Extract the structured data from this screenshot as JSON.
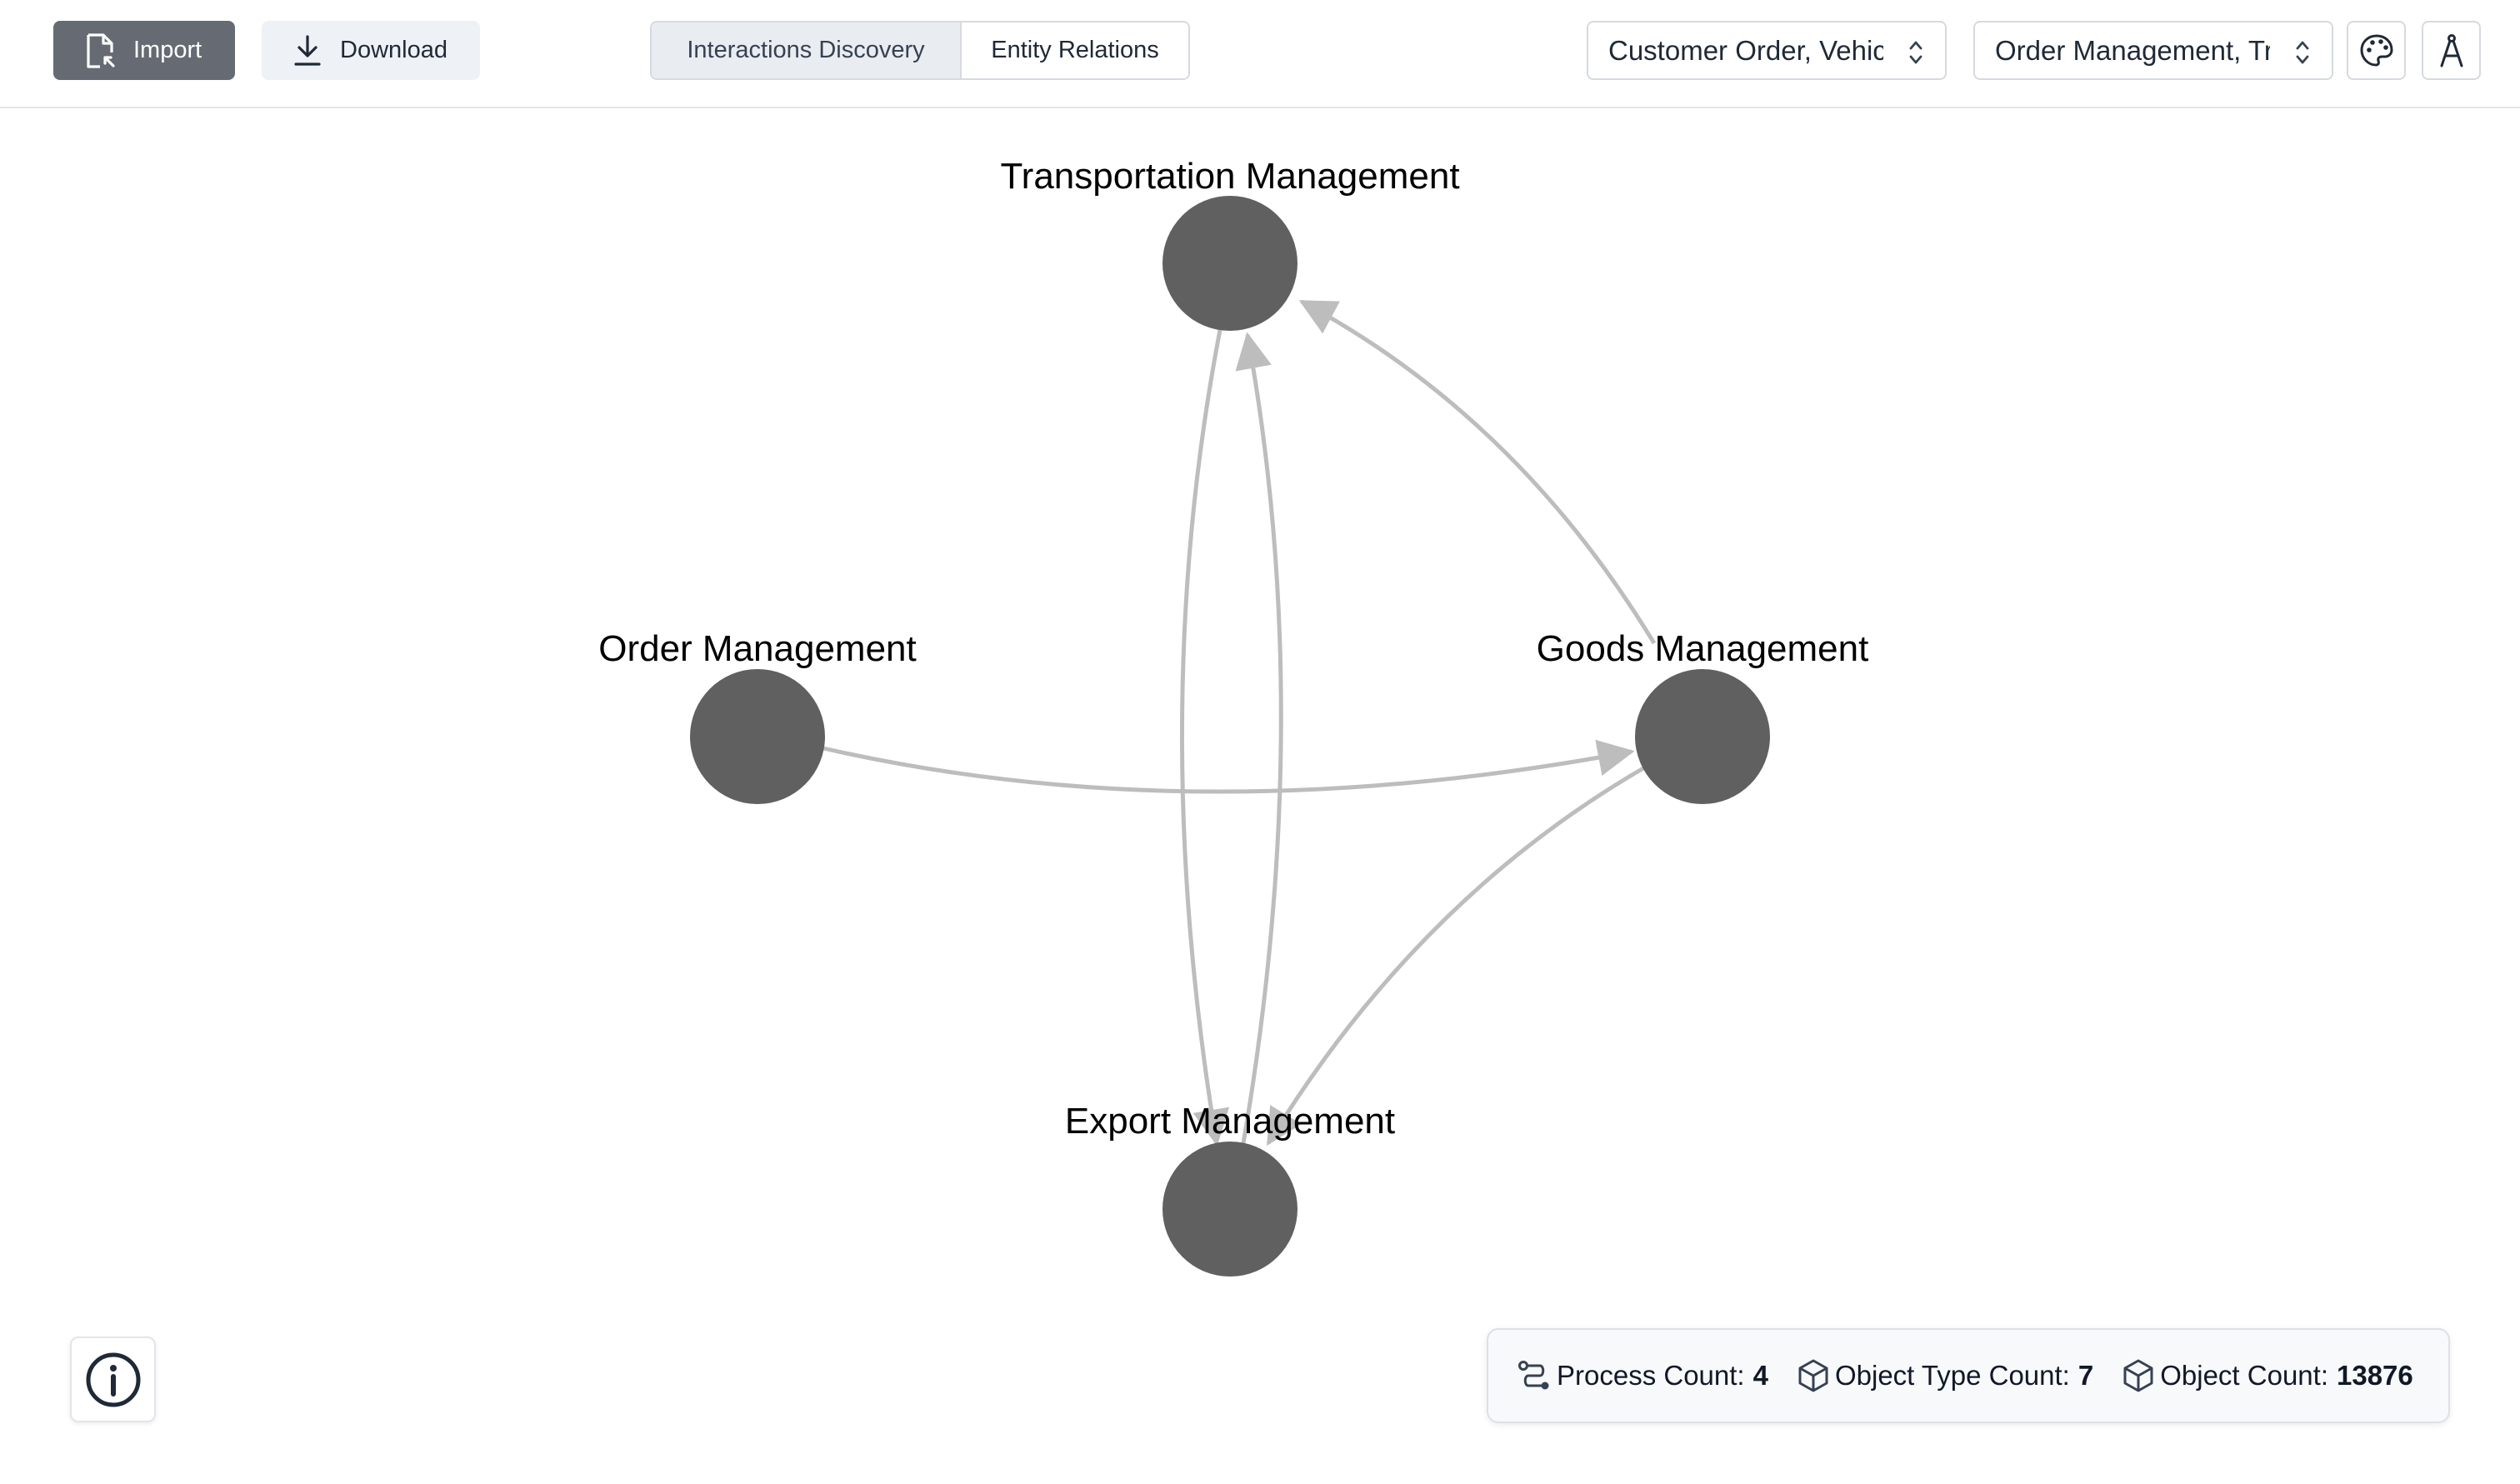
{
  "toolbar": {
    "import_label": "Import",
    "download_label": "Download",
    "tabs": [
      {
        "label": "Interactions Discovery",
        "active": true
      },
      {
        "label": "Entity Relations",
        "active": false
      }
    ],
    "object_type_select": {
      "value": "Customer Order, Vehicle"
    },
    "process_select": {
      "value": "Order Management, Transportation Management"
    },
    "icons": [
      "palette-icon",
      "compass-icon"
    ]
  },
  "graph": {
    "nodes": [
      {
        "id": "transportation",
        "label": "Transportation Management"
      },
      {
        "id": "order",
        "label": "Order Management"
      },
      {
        "id": "goods",
        "label": "Goods Management"
      },
      {
        "id": "export",
        "label": "Export Management"
      }
    ],
    "edges": [
      {
        "from": "order",
        "to": "goods"
      },
      {
        "from": "goods",
        "to": "transportation"
      },
      {
        "from": "transportation",
        "to": "export"
      },
      {
        "from": "export",
        "to": "transportation"
      },
      {
        "from": "goods",
        "to": "export"
      }
    ],
    "colors": {
      "node": "#606060",
      "edge": "#bdbdbd",
      "label": "#000000"
    }
  },
  "stats": {
    "process_label": "Process Count:",
    "process_value": "4",
    "object_type_label": "Object Type Count:",
    "object_type_value": "7",
    "object_label": "Object Count:",
    "object_value": "13876"
  }
}
